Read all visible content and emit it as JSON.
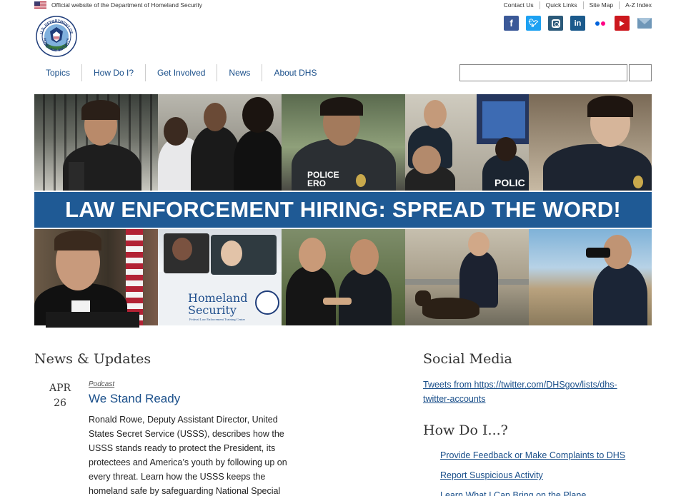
{
  "topbar": {
    "official_text": "Official website of the Department of Homeland Security",
    "links": [
      "Contact Us",
      "Quick Links",
      "Site Map",
      "A-Z Index"
    ]
  },
  "social_icons": [
    "facebook-icon",
    "twitter-icon",
    "instagram-icon",
    "linkedin-icon",
    "flickr-icon",
    "youtube-icon",
    "email-icon"
  ],
  "seal": {
    "top_text": "U.S. DEPARTMENT OF",
    "bottom_text": "HOMELAND SECURITY"
  },
  "nav": [
    "Topics",
    "How Do I?",
    "Get Involved",
    "News",
    "About DHS"
  ],
  "search": {
    "value": "",
    "placeholder": ""
  },
  "banner": {
    "headline": "LAW ENFORCEMENT HIRING: SPREAD THE WORD!",
    "band_color": "#1f5a95",
    "vest_text_1": "POLICE",
    "vest_text_2": "ERO",
    "vest_text_3": "POLIC",
    "vehicle_text_1": "Homeland",
    "vehicle_text_2": "Security",
    "vehicle_text_3": "Federal Law Enforcement Training Center"
  },
  "news": {
    "heading": "News & Updates",
    "item": {
      "month": "APR",
      "day": "26",
      "type": "Podcast",
      "title": "We Stand Ready",
      "body": "Ronald Rowe, Deputy Assistant Director, United States Secret Service (USSS), describes how the USSS stands ready to protect the President, its protectees and America’s youth by following up on every threat.  Learn how the USSS keeps the homeland safe by safeguarding National Special"
    }
  },
  "social_media": {
    "heading": "Social Media",
    "tweets_link": "Tweets from https://twitter.com/DHSgov/lists/dhs-twitter-accounts"
  },
  "how_do_i": {
    "heading": "How Do I...?",
    "links": [
      "Provide Feedback or Make Complaints to DHS",
      "Report Suspicious Activity",
      "Learn What I Can Bring on the Plane"
    ]
  },
  "colors": {
    "link": "#1a4f8a",
    "brand_blue": "#1f5a95"
  }
}
